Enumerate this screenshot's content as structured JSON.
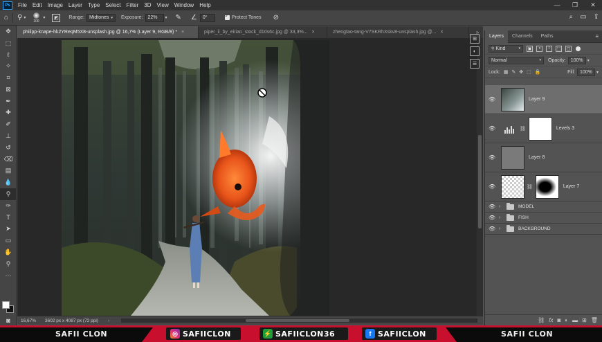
{
  "app": {
    "logo": "Ps",
    "accent": "#31a8ff"
  },
  "menu": [
    "File",
    "Edit",
    "Image",
    "Layer",
    "Type",
    "Select",
    "Filter",
    "3D",
    "View",
    "Window",
    "Help"
  ],
  "window_controls": [
    "—",
    "❐",
    "✕"
  ],
  "options_bar": {
    "brush_size": "100",
    "range_label": "Range:",
    "range_value": "Midtones",
    "exposure_label": "Exposure:",
    "exposure_value": "22%",
    "angle_value": "0°",
    "protect_tones_label": "Protect Tones",
    "protect_tones_checked": true
  },
  "tabs": [
    {
      "label": "philipp-knape-hk2YReqM5X8-unsplash.jpg @ 16,7% (Layer 9, RGB/8) *",
      "active": true
    },
    {
      "label": "piper_ii_by_eirian_stock_d10s6c.jpg @ 33,3%...",
      "active": false
    },
    {
      "label": "zhengtao-tang-V7SKRhXskv8-unsplash.jpg @...",
      "active": false
    }
  ],
  "status": {
    "zoom": "16,67%",
    "dimensions": "3602 px x 4087 px (72 ppi)"
  },
  "panel": {
    "tabs": [
      "Layers",
      "Channels",
      "Paths"
    ],
    "filter_kind": "Kind",
    "blend_mode": "Normal",
    "opacity_label": "Opacity:",
    "opacity_value": "100%",
    "lock_label": "Lock:",
    "fill_label": "Fill:",
    "fill_value": "100%"
  },
  "layers": [
    {
      "name": "Layer 9",
      "selected": true,
      "kind": "image"
    },
    {
      "name": "Levels 3",
      "selected": false,
      "kind": "adjustment"
    },
    {
      "name": "Layer 8",
      "selected": false,
      "kind": "gray"
    },
    {
      "name": "Layer 7",
      "selected": false,
      "kind": "masked"
    }
  ],
  "groups": [
    "MODEL",
    "FISH",
    "BACKGROUND"
  ],
  "banner": {
    "left_name": "SAFII CLON",
    "right_name": "SAFII CLON",
    "instagram": "SAFIICLON",
    "other": "SAFIICLON36",
    "facebook": "SAFIICLON",
    "accent": "#c8102e"
  }
}
